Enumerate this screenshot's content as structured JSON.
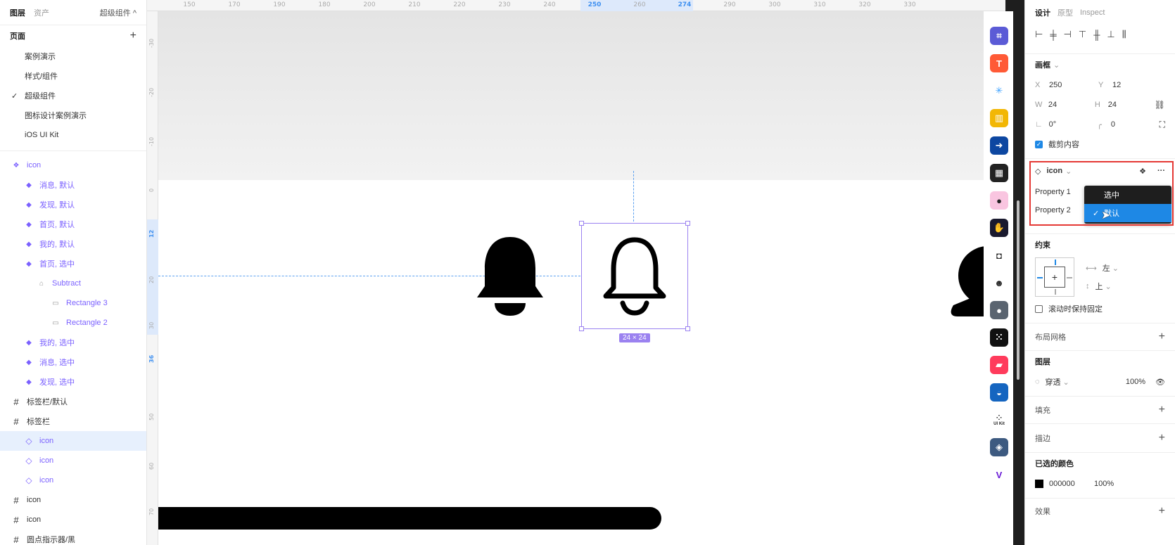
{
  "left_panel": {
    "tabs": [
      "图层",
      "资产"
    ],
    "page_selector": "超级组件 ^",
    "pages_header": "页面",
    "pages": [
      "案例演示",
      "样式/组件",
      "超级组件",
      "图标设计案例演示",
      "iOS UI Kit"
    ],
    "current_page_index": 2,
    "layers": [
      {
        "name": "icon",
        "type": "component-set"
      },
      {
        "name": "消息, 默认",
        "type": "variant"
      },
      {
        "name": "发现, 默认",
        "type": "variant"
      },
      {
        "name": "首页, 默认",
        "type": "variant"
      },
      {
        "name": "我的, 默认",
        "type": "variant"
      },
      {
        "name": "首页, 选中",
        "type": "variant"
      },
      {
        "name": "Subtract",
        "type": "boolean"
      },
      {
        "name": "Rectangle 3",
        "type": "rect"
      },
      {
        "name": "Rectangle 2",
        "type": "rect"
      },
      {
        "name": "我的, 选中",
        "type": "variant"
      },
      {
        "name": "消息, 选中",
        "type": "variant"
      },
      {
        "name": "发现, 选中",
        "type": "variant"
      },
      {
        "name": "标签栏/默认",
        "type": "frame"
      },
      {
        "name": "标签栏",
        "type": "frame"
      },
      {
        "name": "icon",
        "type": "instance",
        "selected": true
      },
      {
        "name": "icon",
        "type": "instance"
      },
      {
        "name": "icon",
        "type": "instance"
      },
      {
        "name": "icon",
        "type": "frame"
      },
      {
        "name": "icon",
        "type": "frame"
      },
      {
        "name": "圆点指示器/黑",
        "type": "frame"
      }
    ]
  },
  "canvas": {
    "ruler_top": [
      "150",
      "170",
      "190",
      "180",
      "200",
      "210",
      "220",
      "230",
      "240",
      "250",
      "260",
      "274",
      "290",
      "300",
      "310",
      "320",
      "330"
    ],
    "ruler_top_highlight": [
      "250",
      "274"
    ],
    "ruler_left": [
      "-30",
      "-20",
      "-10",
      "0",
      "12",
      "20",
      "30",
      "36",
      "50",
      "60",
      "70"
    ],
    "ruler_left_highlight": [
      "12",
      "36"
    ],
    "selection_size": "24 × 24"
  },
  "plugins": {
    "ui_kit_label": "UI Kit",
    "apps": [
      {
        "icon": "selection-icon",
        "color": "#5b5bd6"
      },
      {
        "icon": "text-t-icon",
        "color": "#ff5a36"
      },
      {
        "icon": "snowflake-icon",
        "color": "#ffffff"
      },
      {
        "icon": "palette-icon",
        "color": "#f2b705"
      },
      {
        "icon": "arrow-icon",
        "color": "#0d47a1"
      },
      {
        "icon": "qr-icon",
        "color": "#222222"
      },
      {
        "icon": "pin-icon",
        "color": "#f9c5e0"
      },
      {
        "icon": "hand-icon",
        "color": "#1a1a2e"
      },
      {
        "icon": "logo-icon",
        "color": "#ffffff"
      },
      {
        "icon": "avatar-icon",
        "color": "#ffffff"
      },
      {
        "icon": "profile-icon",
        "color": "#5a6470"
      },
      {
        "icon": "dots-icon",
        "color": "#111111"
      },
      {
        "icon": "shape-icon",
        "color": "#ff3b5c"
      },
      {
        "icon": "wave-icon",
        "color": "#1565c0"
      },
      {
        "icon": "uikit-icon",
        "color": "#ffffff"
      },
      {
        "icon": "cube-icon",
        "color": "#3d5a80"
      },
      {
        "icon": "v-icon",
        "color": "#ffffff"
      }
    ]
  },
  "right_panel": {
    "tabs": [
      "设计",
      "原型",
      "Inspect"
    ],
    "frame_section": "画框",
    "x_label": "X",
    "x": "250",
    "y_label": "Y",
    "y": "12",
    "w_label": "W",
    "w": "24",
    "h_label": "H",
    "h": "24",
    "rotation": "0°",
    "radius": "0",
    "clip_content": "截剪内容",
    "component_name": "icon",
    "property1_label": "Property 1",
    "property2_label": "Property 2",
    "dropdown_options": [
      "选中",
      "默认"
    ],
    "dropdown_selected_index": 1,
    "constraints_section": "约束",
    "constraint_h": "左",
    "constraint_v": "上",
    "fix_on_scroll": "滚动时保持固定",
    "layout_grid_section": "布局网格",
    "layer_section": "图层",
    "blend_mode": "穿透",
    "opacity": "100%",
    "fill_section": "填充",
    "stroke_section": "描边",
    "selected_colors_section": "已选的颜色",
    "color_hex": "000000",
    "color_opacity": "100%",
    "effects_section": "效果",
    "accent_color": "#1e88e5",
    "highlight_color": "#e53935"
  }
}
